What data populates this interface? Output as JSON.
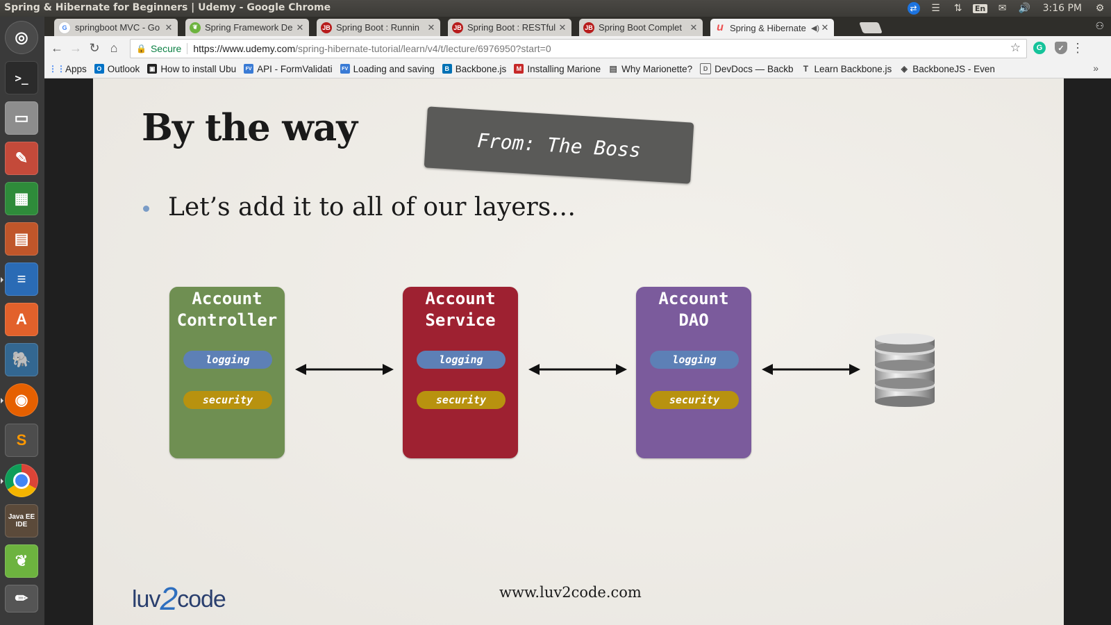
{
  "window": {
    "title": "Spring & Hibernate for Beginners | Udemy - Google Chrome"
  },
  "system_tray": {
    "keyboard_layout": "En",
    "clock": "3:16 PM"
  },
  "tabs": [
    {
      "label": "springboot MVC - Go",
      "favicon": "google-icon",
      "color": "#4285f4",
      "glyph": "G"
    },
    {
      "label": "Spring Framework De",
      "favicon": "spring-icon",
      "color": "#6db33f",
      "glyph": ""
    },
    {
      "label": "Spring Boot : Runnin",
      "favicon": "javabrains-icon",
      "color": "#b71c1c",
      "glyph": "JB"
    },
    {
      "label": "Spring Boot : RESTful",
      "favicon": "javabrains-icon",
      "color": "#b71c1c",
      "glyph": "JB"
    },
    {
      "label": "Spring Boot Complet",
      "favicon": "javabrains-icon",
      "color": "#b71c1c",
      "glyph": "JB"
    },
    {
      "label": "Spring & Hibernate",
      "favicon": "udemy-icon",
      "color": "#ec5252",
      "glyph": "u",
      "active": true
    }
  ],
  "omnibox": {
    "secure_label": "Secure",
    "url_host": "https://www.udemy.com",
    "url_path": "/spring-hibernate-tutorial/learn/v4/t/lecture/6976950?start=0"
  },
  "bookmarks": [
    {
      "label": "Apps",
      "icon": "apps-grid-icon",
      "color": "#4285f4",
      "glyph": "⋮⋮"
    },
    {
      "label": "Outlook",
      "icon": "outlook-icon",
      "color": "#0072c6",
      "glyph": "O"
    },
    {
      "label": "How to install Ubu",
      "icon": "tutorial-icon",
      "color": "#222222",
      "glyph": "▣"
    },
    {
      "label": "API - FormValidati",
      "icon": "formvalidation-icon",
      "color": "#3a7bd5",
      "glyph": "FV"
    },
    {
      "label": "Loading and saving",
      "icon": "formvalidation-icon",
      "color": "#3a7bd5",
      "glyph": "FV"
    },
    {
      "label": "Backbone.js",
      "icon": "backbone-icon",
      "color": "#0071b5",
      "glyph": "B"
    },
    {
      "label": "Installing Marione",
      "icon": "marionette-icon",
      "color": "#c62828",
      "glyph": "M"
    },
    {
      "label": "Why Marionette?",
      "icon": "book-icon",
      "color": "#555555",
      "glyph": "▤"
    },
    {
      "label": "DevDocs — Backb",
      "icon": "devdocs-icon",
      "color": "#666666",
      "glyph": "D"
    },
    {
      "label": "Learn Backbone.js",
      "icon": "text-icon",
      "color": "#444444",
      "glyph": "T"
    },
    {
      "label": "BackboneJS - Even",
      "icon": "diamond-icon",
      "color": "#444444",
      "glyph": "◈"
    }
  ],
  "slide": {
    "title": "By the way",
    "stamp": "From: The Boss",
    "bullet": "Let’s add it to all of our layers…",
    "layers": [
      {
        "name_line1": "Account",
        "name_line2": "Controller",
        "color": "#6f8f52",
        "logging": "logging",
        "security": "security"
      },
      {
        "name_line1": "Account",
        "name_line2": "Service",
        "color": "#9e2131",
        "logging": "logging",
        "security": "security"
      },
      {
        "name_line1": "Account",
        "name_line2": "DAO",
        "color": "#7b5b9c",
        "logging": "logging",
        "security": "security"
      }
    ],
    "footer_logo_left": "luv",
    "footer_logo_mid": "2",
    "footer_logo_right": "code",
    "footer_url": "www.luv2code.com"
  }
}
